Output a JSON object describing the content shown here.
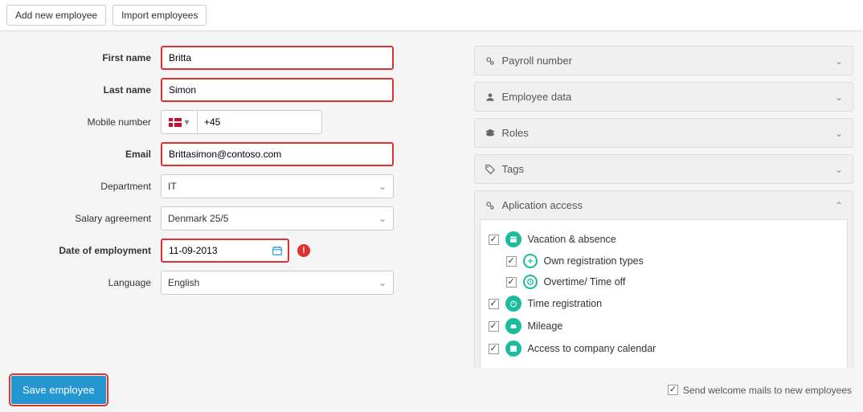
{
  "topbar": {
    "add_employee": "Add new employee",
    "import_employees": "Import employees"
  },
  "form": {
    "first_name_label": "First name",
    "first_name_value": "Britta",
    "last_name_label": "Last name",
    "last_name_value": "Simon",
    "mobile_label": "Mobile number",
    "mobile_prefix": "+45",
    "mobile_value": "",
    "email_label": "Email",
    "email_value": "Brittasimon@contoso.com",
    "department_label": "Department",
    "department_value": "IT",
    "salary_label": "Salary agreement",
    "salary_value": "Denmark 25/5",
    "date_label": "Date of employment",
    "date_value": "11-09-2013",
    "language_label": "Language",
    "language_value": "English"
  },
  "panels": {
    "payroll": "Payroll number",
    "employee_data": "Employee data",
    "roles": "Roles",
    "tags": "Tags",
    "app_access": "Aplication access"
  },
  "access": {
    "vacation": "Vacation & absence",
    "own_reg": "Own registration types",
    "overtime": "Overtime/ Time off",
    "time_reg": "Time registration",
    "mileage": "Mileage",
    "calendar": "Access to company calendar"
  },
  "footer": {
    "save": "Save employee",
    "welcome_mail": "Send welcome mails to new employees"
  },
  "colors": {
    "primary": "#2497d1",
    "accent": "#1abc9c",
    "error": "#e03131"
  }
}
